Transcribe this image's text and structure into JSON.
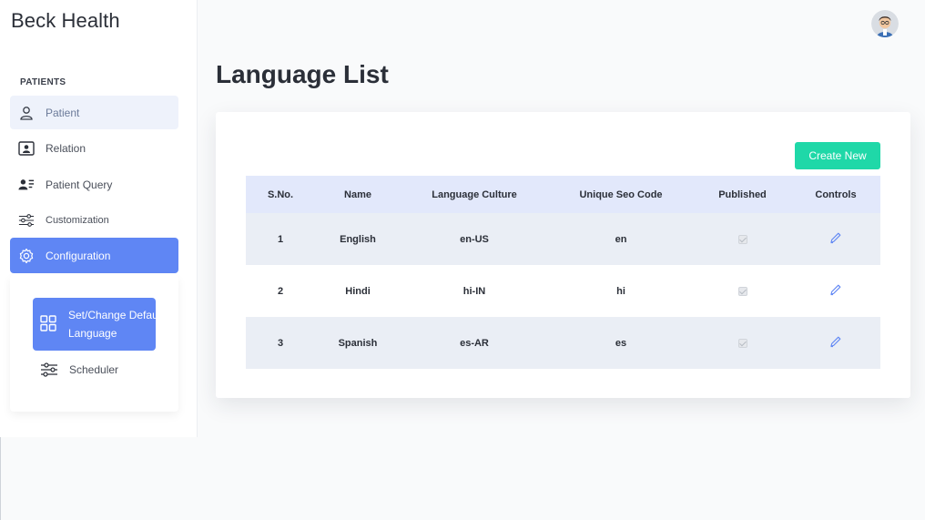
{
  "brand": "Beck Health",
  "sidebar": {
    "section_title": "PATIENTS",
    "items": [
      {
        "label": "Patient",
        "icon": "user-icon"
      },
      {
        "label": "Relation",
        "icon": "contact-card-icon"
      },
      {
        "label": "Patient Query",
        "icon": "user-list-icon"
      },
      {
        "label": "Customization",
        "icon": "sliders-icon"
      },
      {
        "label": "Configuration",
        "icon": "gear-icon"
      }
    ],
    "subitems": [
      {
        "label": "Set/Change Default Language",
        "line1": "Set/Change Default",
        "line2": "Language",
        "icon": "grid-icon"
      },
      {
        "label": "Scheduler",
        "icon": "sliders-icon"
      }
    ]
  },
  "header": {
    "avatar": "user-avatar"
  },
  "main": {
    "title": "Language List",
    "create_label": "Create New",
    "table": {
      "columns": [
        "S.No.",
        "Name",
        "Language Culture",
        "Unique Seo Code",
        "Published",
        "Controls"
      ],
      "rows": [
        {
          "sno": "1",
          "name": "English",
          "culture": "en-US",
          "seo": "en",
          "published": true
        },
        {
          "sno": "2",
          "name": "Hindi",
          "culture": "hi-IN",
          "seo": "hi",
          "published": true
        },
        {
          "sno": "3",
          "name": "Spanish",
          "culture": "es-AR",
          "seo": "es",
          "published": true
        }
      ]
    }
  },
  "colors": {
    "accent": "#5f86f4",
    "create_button": "#1fd8a8",
    "table_header": "#e2e8fb",
    "row_stripe": "#eaeef5",
    "edit_icon": "#5f86f4"
  }
}
